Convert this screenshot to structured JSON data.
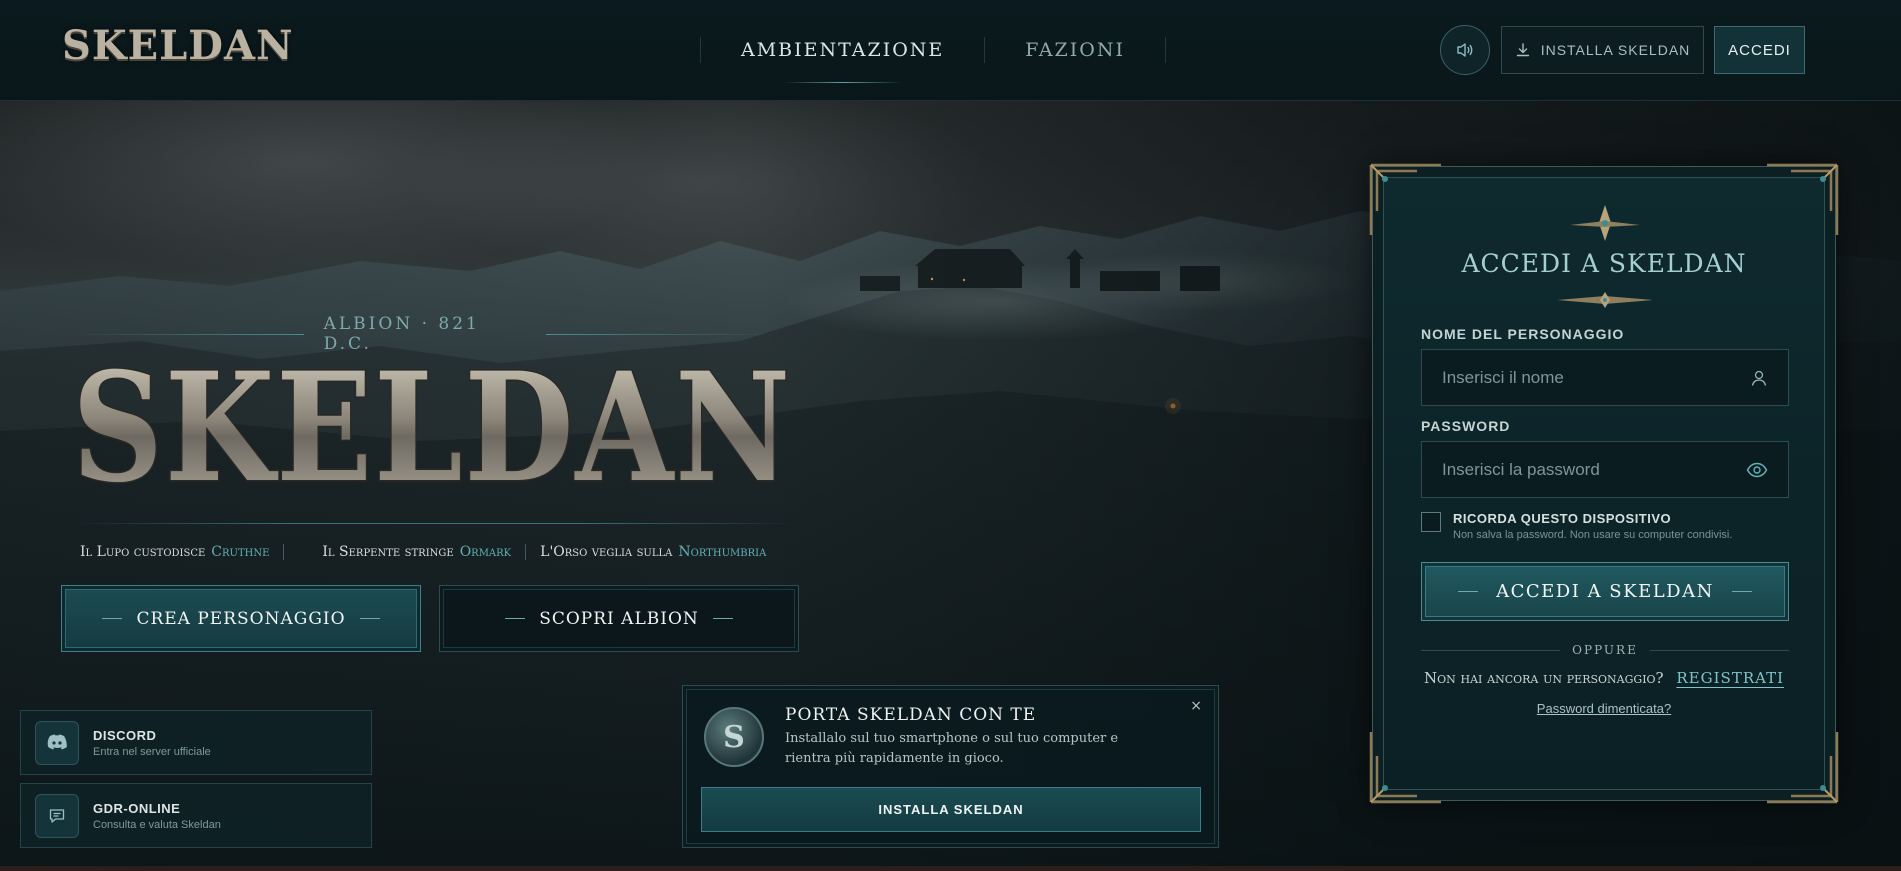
{
  "header": {
    "logo": "SKELDAN",
    "nav": [
      {
        "label": "AMBIENTAZIONE",
        "active": true
      },
      {
        "label": "FAZIONI",
        "active": false
      }
    ],
    "sound_icon": "speaker-icon",
    "install_label": "INSTALLA SKELDAN",
    "install_icon": "download-icon",
    "login_label": "ACCEDI"
  },
  "hero": {
    "eyebrow": "ALBION · 821 D.C.",
    "title": "SKELDAN",
    "creeds": [
      {
        "text": "Il Lupo custodisce",
        "place": "Cruthne"
      },
      {
        "text": "Il Serpente stringe",
        "place": "Ormark"
      },
      {
        "text": "L'Orso veglia sulla",
        "place": "Northumbria"
      }
    ],
    "create_label": "CREA PERSONAGGIO",
    "discover_label": "SCOPRI ALBION"
  },
  "side_cards": [
    {
      "title": "DISCORD",
      "subtitle": "Entra nel server ufficiale",
      "icon": "discord-icon"
    },
    {
      "title": "GDR-ONLINE",
      "subtitle": "Consulta e valuta Skeldan",
      "icon": "chat-icon"
    }
  ],
  "popup": {
    "title": "PORTA SKELDAN CON TE",
    "text": "Installalo sul tuo smartphone o sul tuo computer e rientra più rapidamente in gioco.",
    "close": "×",
    "install_label": "INSTALLA SKELDAN",
    "emblem": "S"
  },
  "login": {
    "title": "ACCEDI A SKELDAN",
    "name_label": "NOME DEL PERSONAGGIO",
    "name_placeholder": "Inserisci il nome",
    "name_value": "",
    "password_label": "PASSWORD",
    "password_placeholder": "Inserisci la password",
    "password_value": "",
    "remember_label": "RICORDA QUESTO DISPOSITIVO",
    "remember_hint": "Non salva la password. Non usare su computer condivisi.",
    "remember_checked": false,
    "submit_label": "ACCEDI A SKELDAN",
    "divider": "OPPURE",
    "register_prompt": "Non hai ancora un personaggio?",
    "register_link": "REGISTRATI",
    "forgot_link": "Password dimenticata?"
  },
  "colors": {
    "accent": "#3f8189",
    "accent_text": "#62b0b5",
    "background": "#0a1518"
  }
}
